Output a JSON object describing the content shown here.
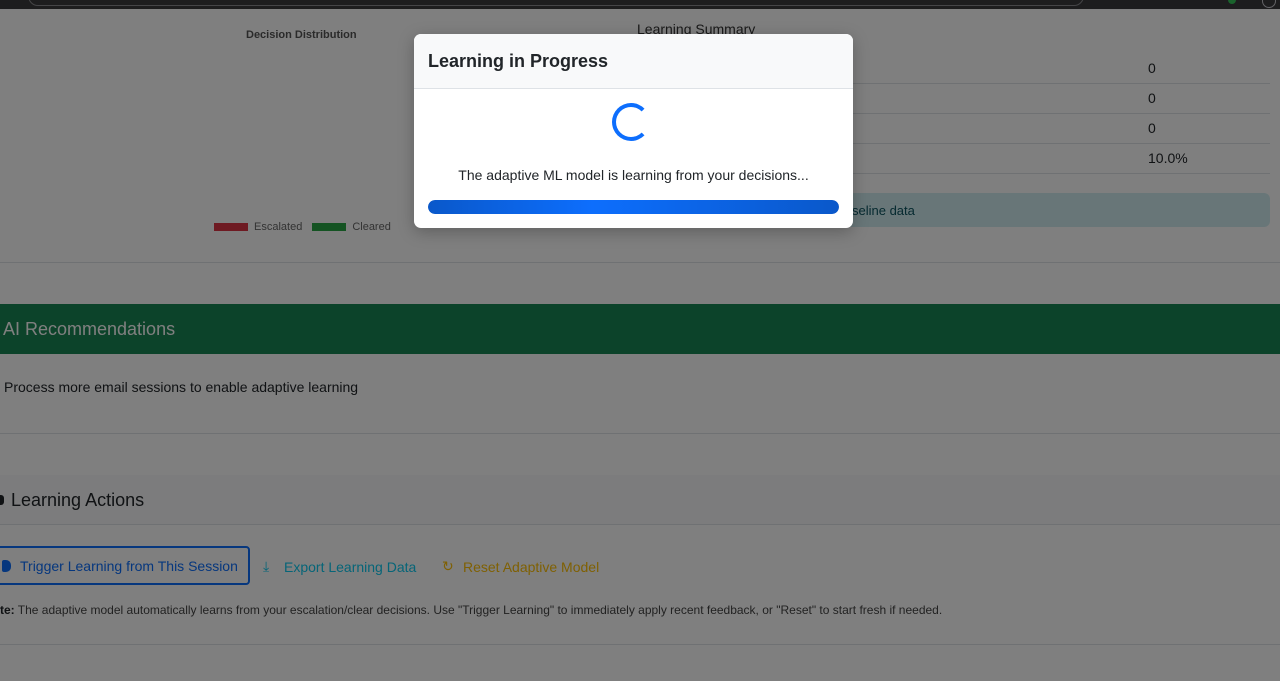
{
  "analytics": {
    "chart_title": "Decision Distribution",
    "legend": [
      {
        "label": "Escalated",
        "color": "#dc3545"
      },
      {
        "label": "Cleared",
        "color": "#28a745"
      }
    ],
    "summary_title": "Learning Summary",
    "summary_values": [
      "0",
      "0",
      "0",
      "10.0%"
    ],
    "info_text": "seline data"
  },
  "recommendations": {
    "title": "AI Recommendations",
    "items": [
      "Process more email sessions to enable adaptive learning"
    ]
  },
  "actions": {
    "title": "Learning Actions",
    "trigger_label": "Trigger Learning from This Session",
    "export_label": "Export Learning Data",
    "reset_label": "Reset Adaptive Model",
    "note_prefix": "te:",
    "note_text": " The adaptive model automatically learns from your escalation/clear decisions. Use \"Trigger Learning\" to immediately apply recent feedback, or \"Reset\" to start fresh if needed."
  },
  "modal": {
    "title": "Learning in Progress",
    "message": "The adaptive ML model is learning from your decisions...",
    "progress": 1.0
  },
  "colors": {
    "primary": "#0d6efd",
    "success": "#198754",
    "info": "#0dcaf0",
    "warning": "#ffc107"
  }
}
